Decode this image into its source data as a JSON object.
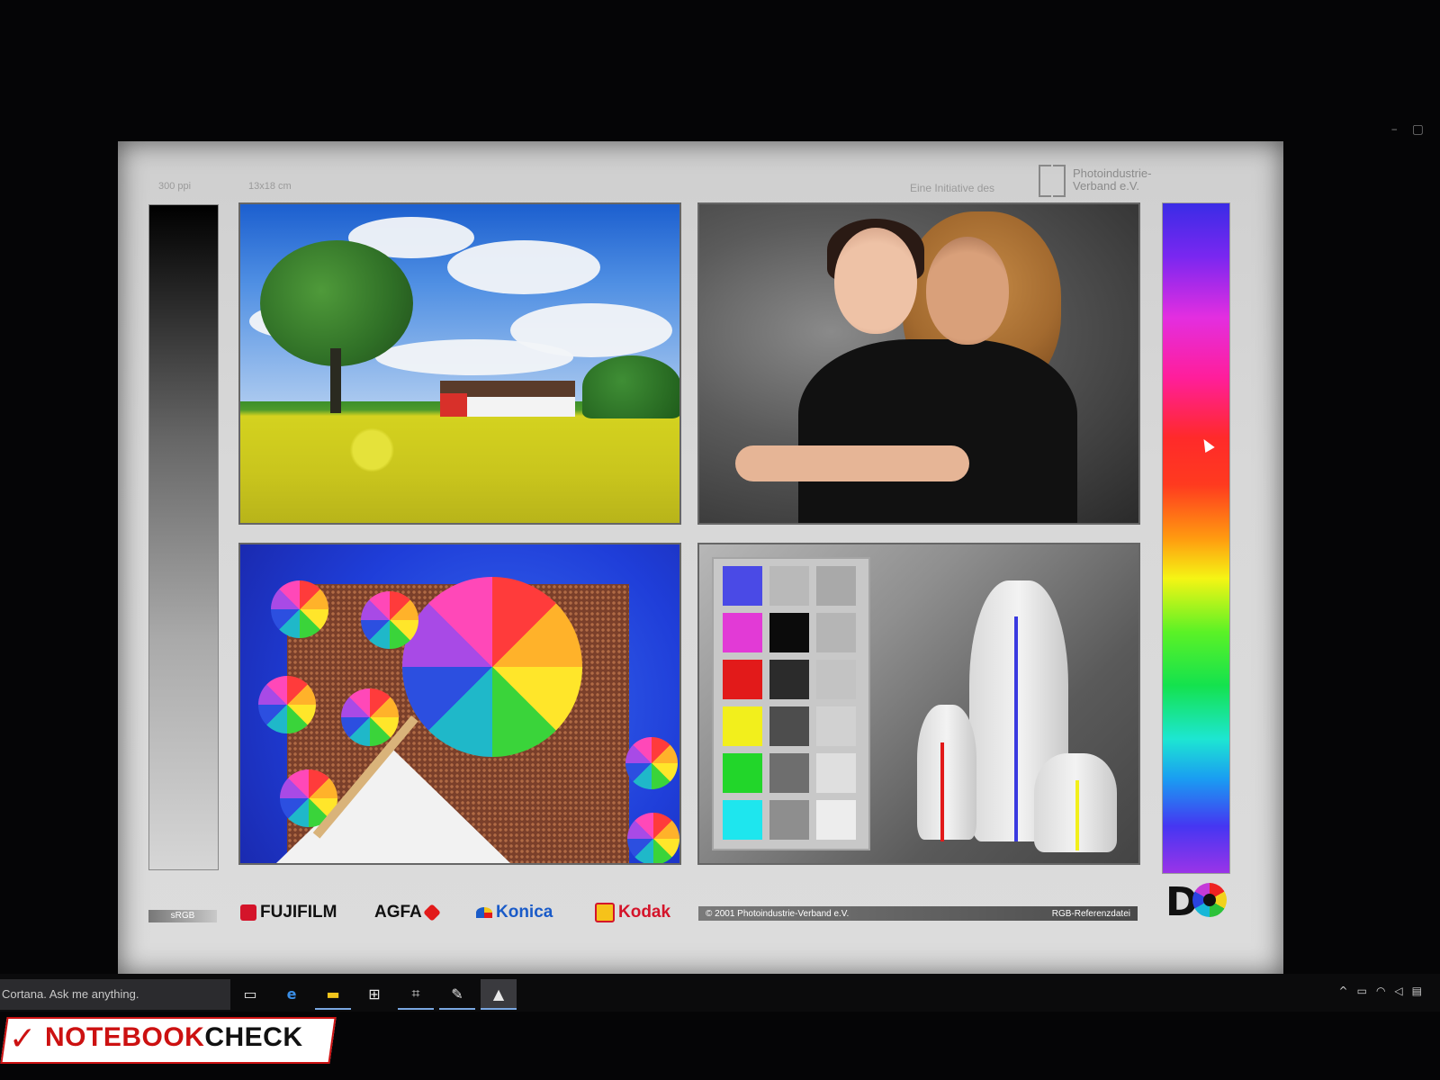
{
  "chart_header": {
    "resolution": "300 ppi",
    "print_size": "13x18 cm",
    "initiative_label": "Eine Initiative des",
    "org_name_line1": "Photoindustrie-",
    "org_name_line2": "Verband e.V."
  },
  "footer": {
    "color_space": "sRGB",
    "brands": [
      "FUJIFILM",
      "AGFA",
      "Konica",
      "Kodak"
    ],
    "copyright": "© 2001  Photoindustrie-Verband e.V.",
    "file_label": "RGB-Referenzdatei"
  },
  "taskbar": {
    "search_placeholder": "Cortana. Ask me anything.",
    "icons": [
      "task-view-icon",
      "edge-icon",
      "file-explorer-icon",
      "store-icon",
      "app-icon",
      "paint-icon",
      "photos-icon"
    ]
  },
  "watermark": {
    "part1": "NOTEBOOK",
    "part2": "CHECK"
  },
  "colors": {
    "brand_red": "#cc1111",
    "patch_blue": "#4a4ae6",
    "patch_magenta": "#e23ad6",
    "patch_red": "#e21a1a",
    "patch_yellow": "#f2ef1c",
    "patch_green": "#22d62a",
    "patch_cyan": "#1ee6ee"
  }
}
